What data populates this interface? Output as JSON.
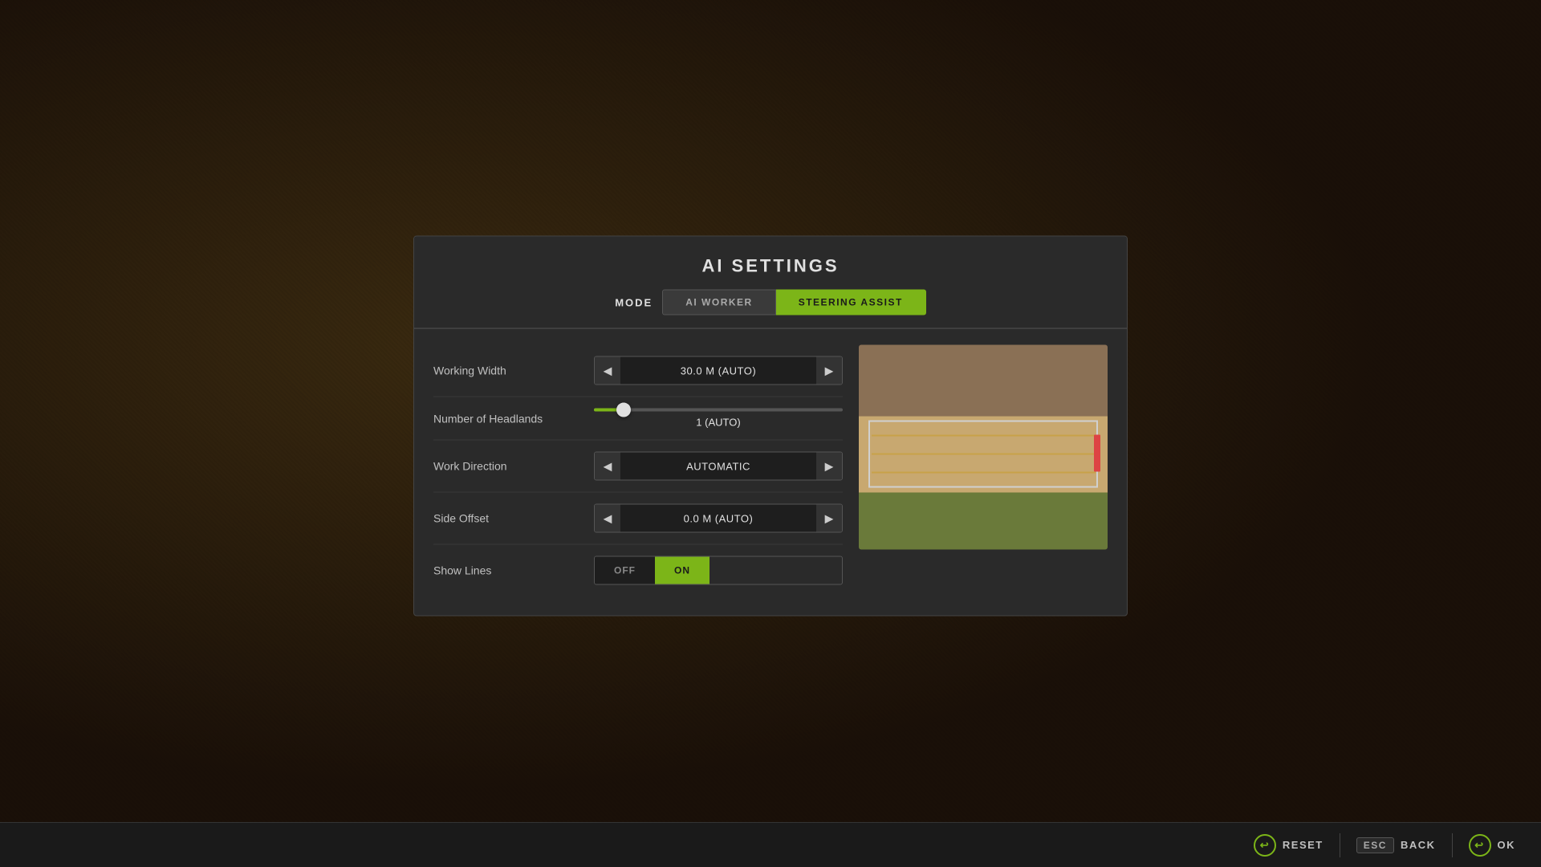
{
  "background": {
    "color": "#1a1008"
  },
  "modal": {
    "title": "AI SETTINGS",
    "tabs": {
      "mode_label": "MODE",
      "items": [
        {
          "id": "ai_worker",
          "label": "AI WORKER",
          "active": false
        },
        {
          "id": "steering_assist",
          "label": "STEERING ASSIST",
          "active": true
        }
      ]
    },
    "settings": [
      {
        "id": "working_width",
        "label": "Working Width",
        "type": "arrow",
        "value": "30.0 M (AUTO)"
      },
      {
        "id": "number_of_headlands",
        "label": "Number of Headlands",
        "type": "slider",
        "value": "1 (AUTO)",
        "slider_percent": 12
      },
      {
        "id": "work_direction",
        "label": "Work Direction",
        "type": "arrow",
        "value": "AUTOMATIC"
      },
      {
        "id": "side_offset",
        "label": "Side Offset",
        "type": "arrow",
        "value": "0.0 M (AUTO)"
      },
      {
        "id": "show_lines",
        "label": "Show Lines",
        "type": "toggle",
        "off_label": "OFF",
        "on_label": "ON",
        "value": "on"
      }
    ]
  },
  "bottom_bar": {
    "buttons": [
      {
        "id": "reset",
        "icon": "↩",
        "key": null,
        "label": "RESET"
      },
      {
        "id": "back",
        "icon": null,
        "key": "ESC",
        "label": "BACK"
      },
      {
        "id": "ok",
        "icon": "↩",
        "key": null,
        "label": "OK"
      }
    ]
  }
}
